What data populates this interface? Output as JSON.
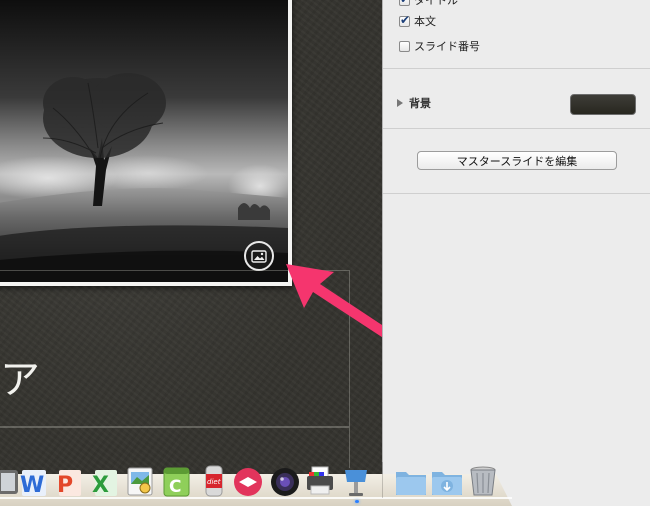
{
  "inspector": {
    "checkboxes": [
      {
        "label": "タイトル",
        "checked": true
      },
      {
        "label": "本文",
        "checked": true
      },
      {
        "label": "スライド番号",
        "checked": false
      }
    ],
    "background_label": "背景",
    "background_color": "#33322d",
    "edit_master_button": "マスタースライドを編集"
  },
  "slide": {
    "title_glyph": "ア",
    "image_badge_icon": "image-icon"
  },
  "annotation": {
    "arrow_color": "#f5356e"
  },
  "dock": {
    "apps": [
      {
        "name": "app-icon-partial"
      },
      {
        "name": "word-icon",
        "glyph": "W"
      },
      {
        "name": "powerpoint-icon",
        "glyph": "P"
      },
      {
        "name": "excel-icon",
        "glyph": "X"
      },
      {
        "name": "preview-icon"
      },
      {
        "name": "calendar-icon",
        "glyph": "C"
      },
      {
        "name": "diet-coke-icon",
        "glyph": "diet"
      },
      {
        "name": "skitch-icon"
      },
      {
        "name": "camera-icon"
      },
      {
        "name": "printer-icon"
      },
      {
        "name": "keynote-icon"
      },
      {
        "name": "folder-icon"
      },
      {
        "name": "downloads-icon"
      },
      {
        "name": "trash-icon"
      }
    ]
  }
}
